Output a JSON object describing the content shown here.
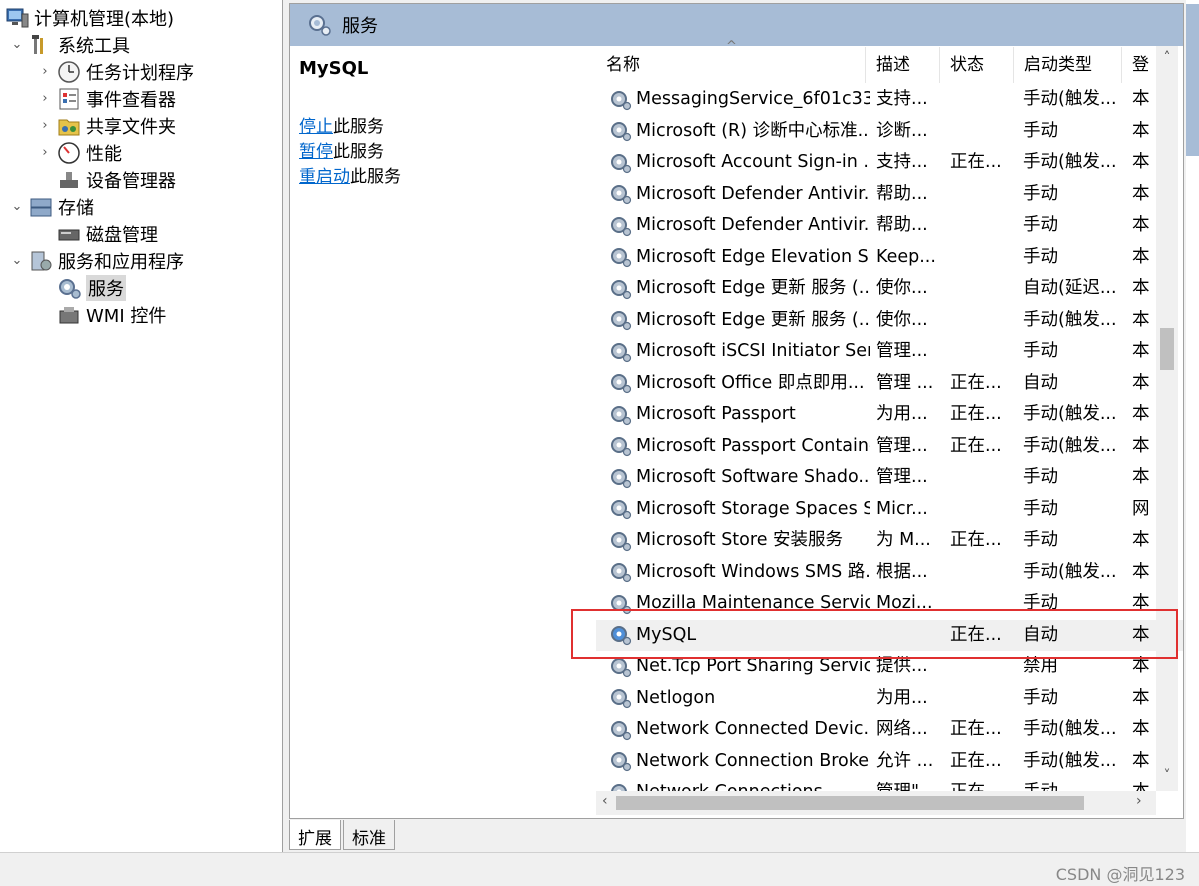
{
  "tree": {
    "root": "计算机管理(本地)",
    "items": [
      {
        "label": "系统工具"
      },
      {
        "label": "任务计划程序"
      },
      {
        "label": "事件查看器"
      },
      {
        "label": "共享文件夹"
      },
      {
        "label": "性能"
      },
      {
        "label": "设备管理器"
      },
      {
        "label": "存储"
      },
      {
        "label": "磁盘管理"
      },
      {
        "label": "服务和应用程序"
      },
      {
        "label": "服务"
      },
      {
        "label": "WMI 控件"
      }
    ]
  },
  "panel": {
    "title": "服务",
    "selected_service": "MySQL",
    "actions": [
      {
        "link": "停止",
        "rest": "此服务"
      },
      {
        "link": "暂停",
        "rest": "此服务"
      },
      {
        "link": "重启动",
        "rest": "此服务"
      }
    ]
  },
  "table": {
    "sort_arrow": "^",
    "columns": [
      "名称",
      "描述",
      "状态",
      "启动类型",
      "登"
    ],
    "rows": [
      {
        "name": "MessagingService_6f01c33",
        "desc": "支持...",
        "status": "",
        "type": "手动(触发...",
        "logon": "本"
      },
      {
        "name": "Microsoft (R) 诊断中心标准...",
        "desc": "诊断...",
        "status": "",
        "type": "手动",
        "logon": "本"
      },
      {
        "name": "Microsoft Account Sign-in ...",
        "desc": "支持...",
        "status": "正在...",
        "type": "手动(触发...",
        "logon": "本"
      },
      {
        "name": "Microsoft Defender Antivir...",
        "desc": "帮助...",
        "status": "",
        "type": "手动",
        "logon": "本"
      },
      {
        "name": "Microsoft Defender Antivir...",
        "desc": "帮助...",
        "status": "",
        "type": "手动",
        "logon": "本"
      },
      {
        "name": "Microsoft Edge Elevation S...",
        "desc": "Keep...",
        "status": "",
        "type": "手动",
        "logon": "本"
      },
      {
        "name": "Microsoft Edge 更新 服务 (...",
        "desc": "使你...",
        "status": "",
        "type": "自动(延迟...",
        "logon": "本"
      },
      {
        "name": "Microsoft Edge 更新 服务 (...",
        "desc": "使你...",
        "status": "",
        "type": "手动(触发...",
        "logon": "本"
      },
      {
        "name": "Microsoft iSCSI Initiator Ser...",
        "desc": "管理...",
        "status": "",
        "type": "手动",
        "logon": "本"
      },
      {
        "name": "Microsoft Office 即点即用...",
        "desc": "管理 ...",
        "status": "正在...",
        "type": "自动",
        "logon": "本"
      },
      {
        "name": "Microsoft Passport",
        "desc": "为用...",
        "status": "正在...",
        "type": "手动(触发...",
        "logon": "本"
      },
      {
        "name": "Microsoft Passport Container",
        "desc": "管理...",
        "status": "正在...",
        "type": "手动(触发...",
        "logon": "本"
      },
      {
        "name": "Microsoft Software Shado...",
        "desc": "管理...",
        "status": "",
        "type": "手动",
        "logon": "本"
      },
      {
        "name": "Microsoft Storage Spaces S...",
        "desc": "Micr...",
        "status": "",
        "type": "手动",
        "logon": "网"
      },
      {
        "name": "Microsoft Store 安装服务",
        "desc": "为 M...",
        "status": "正在...",
        "type": "手动",
        "logon": "本"
      },
      {
        "name": "Microsoft Windows SMS 路...",
        "desc": "根据...",
        "status": "",
        "type": "手动(触发...",
        "logon": "本"
      },
      {
        "name": "Mozilla Maintenance Service",
        "desc": "Mozi...",
        "status": "",
        "type": "手动",
        "logon": "本"
      },
      {
        "name": "MySQL",
        "desc": "",
        "status": "正在...",
        "type": "自动",
        "logon": "本"
      },
      {
        "name": "Net.Tcp Port Sharing Service",
        "desc": "提供...",
        "status": "",
        "type": "禁用",
        "logon": "本"
      },
      {
        "name": "Netlogon",
        "desc": "为用...",
        "status": "",
        "type": "手动",
        "logon": "本"
      },
      {
        "name": "Network Connected Devic...",
        "desc": "网络...",
        "status": "正在...",
        "type": "手动(触发...",
        "logon": "本"
      },
      {
        "name": "Network Connection Broker",
        "desc": "允许 ...",
        "status": "正在...",
        "type": "手动(触发...",
        "logon": "本"
      },
      {
        "name": "Network Connections",
        "desc": "管理\"...",
        "status": "正在...",
        "type": "手动",
        "logon": "本"
      }
    ]
  },
  "tabs": [
    "扩展",
    "标准"
  ],
  "watermark": "CSDN @洞见123",
  "colors": {
    "header": "#a7bcd6",
    "link": "#0066cc",
    "highlight_box": "#e03030"
  }
}
